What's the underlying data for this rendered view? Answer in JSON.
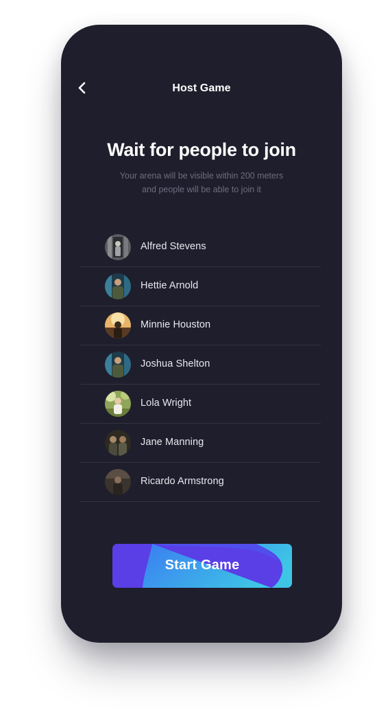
{
  "header": {
    "title": "Host Game",
    "back_icon": "chevron-left-icon"
  },
  "main": {
    "heading": "Wait for people to join",
    "subtitle_line1": "Your arena will be visible within 200 meters",
    "subtitle_line2": "and people will be able to join it"
  },
  "players": [
    {
      "name": "Alfred Stevens"
    },
    {
      "name": "Hettie Arnold"
    },
    {
      "name": "Minnie Houston"
    },
    {
      "name": "Joshua Shelton"
    },
    {
      "name": "Lola Wright"
    },
    {
      "name": "Jane Manning"
    },
    {
      "name": "Ricardo Armstrong"
    }
  ],
  "actions": {
    "start_label": "Start Game"
  },
  "colors": {
    "phone_background": "#1f1e2c",
    "divider": "#34333f",
    "button_gradient_start": "#5a3ee6",
    "button_gradient_end": "#3ec5e6"
  }
}
